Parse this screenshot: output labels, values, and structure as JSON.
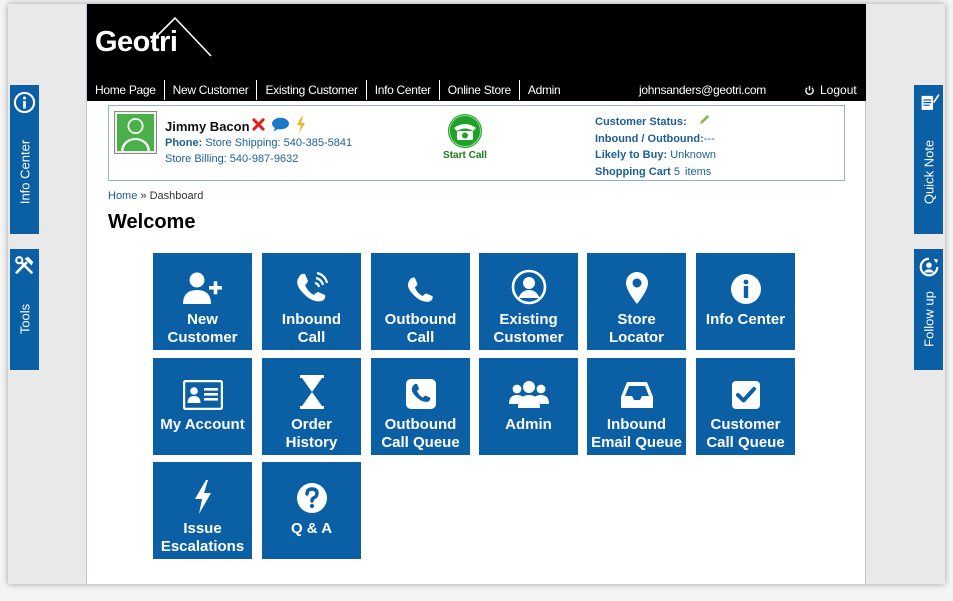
{
  "brand": {
    "logo": "Geotri"
  },
  "nav": {
    "items": [
      "Home Page",
      "New Customer",
      "Existing Customer",
      "Info Center",
      "Online Store",
      "Admin"
    ],
    "user_email": "johnsanders@geotri.com",
    "logout_label": "Logout"
  },
  "customer": {
    "name": "Jimmy Bacon",
    "phone_label": "Phone:",
    "phone_shipping": "Store Shipping: 540-385-5841",
    "phone_billing": "Store Billing: 540-987-9632",
    "start_call_label": "Start Call",
    "status": {
      "customer_status_label": "Customer Status:",
      "inbound_outbound_label": "Inbound / Outbound:",
      "inbound_outbound_value": "---",
      "likely_label": "Likely to Buy:",
      "likely_value": "Unknown",
      "cart_label": "Shopping Cart",
      "cart_count": "5",
      "cart_suffix": "items"
    }
  },
  "breadcrumb": {
    "home": "Home",
    "separator": "»",
    "current": "Dashboard"
  },
  "page_title": "Welcome",
  "tiles": [
    {
      "line1": "New",
      "line2": "Customer",
      "icon": "add-user-icon"
    },
    {
      "line1": "Inbound",
      "line2": "Call",
      "icon": "ringing-phone-icon"
    },
    {
      "line1": "Outbound",
      "line2": "Call",
      "icon": "phone-icon"
    },
    {
      "line1": "Existing",
      "line2": "Customer",
      "icon": "user-circle-icon"
    },
    {
      "line1": "Store",
      "line2": "Locator",
      "icon": "map-pin-icon"
    },
    {
      "line1": "Info Center",
      "line2": "",
      "icon": "info-icon"
    },
    {
      "line1": "My Account",
      "line2": "",
      "icon": "id-card-icon"
    },
    {
      "line1": "Order",
      "line2": "History",
      "icon": "hourglass-icon"
    },
    {
      "line1": "Outbound",
      "line2": "Call Queue",
      "icon": "phone-square-icon"
    },
    {
      "line1": "Admin",
      "line2": "",
      "icon": "group-icon"
    },
    {
      "line1": "Inbound",
      "line2": "Email Queue",
      "icon": "inbox-icon"
    },
    {
      "line1": "Customer",
      "line2": "Call Queue",
      "icon": "check-square-icon"
    },
    {
      "line1": "Issue",
      "line2": "Escalations",
      "icon": "bolt-icon"
    },
    {
      "line1": "Q & A",
      "line2": "",
      "icon": "question-circle-icon"
    }
  ],
  "side_tabs": {
    "left": [
      {
        "label": "Info Center",
        "icon": "info-icon"
      },
      {
        "label": "Tools",
        "icon": "tools-icon"
      }
    ],
    "right": [
      {
        "label": "Quick Note",
        "icon": "note-icon"
      },
      {
        "label": "Follow up",
        "icon": "follow-up-icon"
      }
    ]
  },
  "colors": {
    "tile_blue": "#0b5fa5",
    "link_blue": "#1c5f96",
    "header_black": "#000000",
    "start_call_green": "#1a7a1a"
  }
}
